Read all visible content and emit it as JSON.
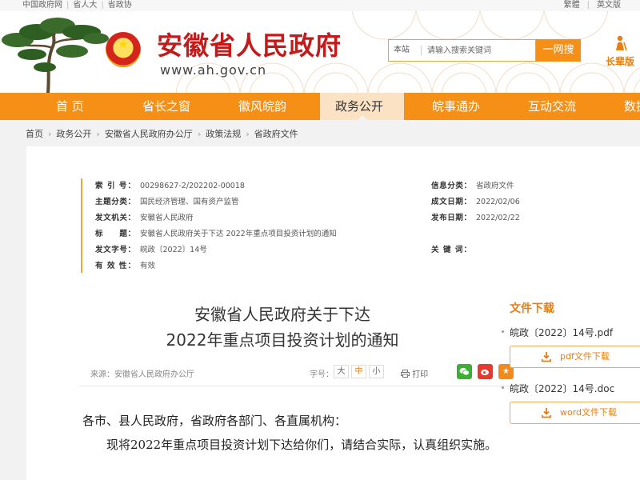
{
  "top_links": [
    "中国政府网",
    "省人大",
    "省政协"
  ],
  "lang_links": [
    "繁體",
    "英文版"
  ],
  "site": {
    "title": "安徽省人民政府",
    "url": "www.ah.gov.cn"
  },
  "search": {
    "scope": "本站",
    "placeholder": "请输入搜索关键词",
    "button": "一网搜"
  },
  "elder_mode": "长辈版",
  "nav": {
    "items": [
      "首 页",
      "省长之窗",
      "徽风皖韵",
      "政务公开",
      "皖事通办",
      "互动交流",
      "数据"
    ],
    "active": "政务公开"
  },
  "breadcrumb": [
    "首页",
    "政务公开",
    "安徽省人民政府办公厅",
    "政策法规",
    "省政府文件"
  ],
  "meta": {
    "index_no_label": "索 引 号：",
    "index_no": "00298627-2/202202-00018",
    "topic_label": "主题分类：",
    "topic": "国民经济管理、国有资产监管",
    "issuer_label": "发文机关：",
    "issuer": "安徽省人民政府",
    "title_label": "标　　题：",
    "title": "安徽省人民政府关于下达 2022年重点项目投资计划的通知",
    "doc_no_label": "发文字号：",
    "doc_no": "皖政〔2022〕14号",
    "validity_label": "有 效 性：",
    "validity": "有效",
    "info_cat_label": "信息分类：",
    "info_cat": "省政府文件",
    "created_label": "成文日期：",
    "created": "2022/02/06",
    "published_label": "发布日期：",
    "published": "2022/02/22",
    "keywords_label": "关 键 词："
  },
  "article": {
    "title_line1": "安徽省人民政府关于下达",
    "title_line2": "2022年重点项目投资计划的通知",
    "source": "来源：安徽省人民政府办公厅",
    "font_size_label": "字号：",
    "font_sizes": [
      "大",
      "中",
      "小"
    ],
    "print": "打印",
    "salutation": "各市、县人民政府，省政府各部门、各直属机构：",
    "paragraph1": "现将2022年重点项目投资计划下达给你们，请结合实际，认真组织实施。"
  },
  "downloads": {
    "title": "文件下载",
    "items": [
      {
        "name": "皖政〔2022〕14号.pdf",
        "button": "pdf文件下载"
      },
      {
        "name": "皖政〔2022〕14号.doc",
        "button": "word文件下载"
      }
    ]
  },
  "colors": {
    "accent": "#f58f15",
    "title_red": "#c41a1a",
    "link_orange": "#e67e14"
  },
  "icons": [
    "emblem-icon",
    "elder-mode-icon",
    "wechat-icon",
    "weibo-icon",
    "favorite-icon",
    "print-icon",
    "download-icon"
  ]
}
